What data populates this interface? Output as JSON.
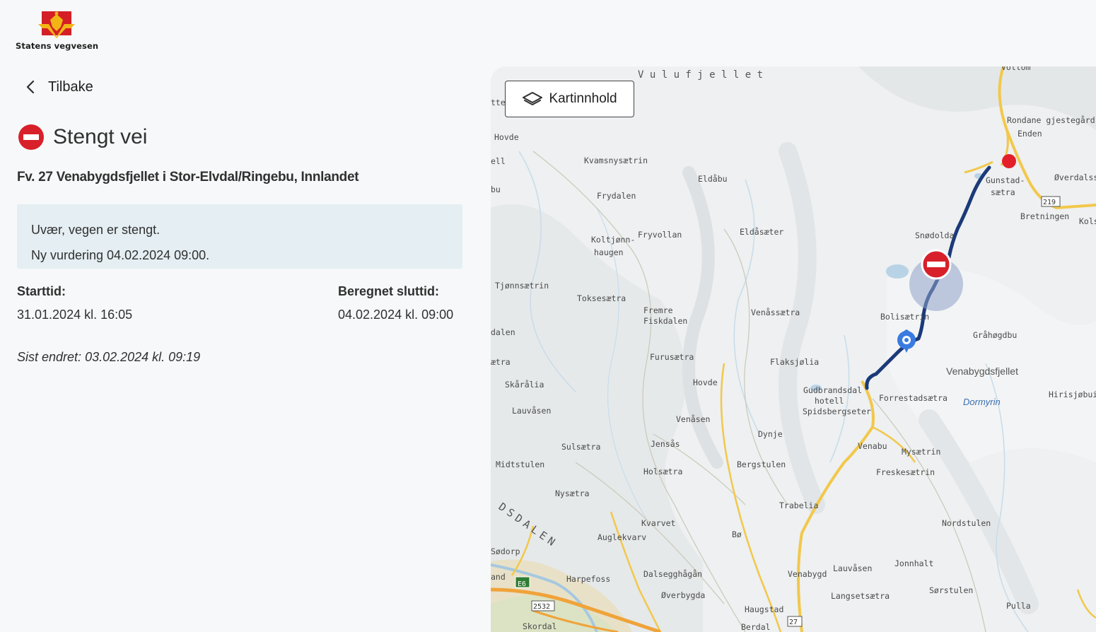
{
  "header": {
    "logo_text": "Statens vegvesen"
  },
  "nav": {
    "back_label": "Tilbake"
  },
  "incident": {
    "status": "Stengt vei",
    "road": "Fv. 27 Venabygdsfjellet i Stor-Elvdal/Ringebu, Innlandet",
    "message_line1": "Uvær, vegen er stengt.",
    "message_line2": "Ny vurdering 04.02.2024 09:00.",
    "start_label": "Starttid:",
    "start_value": "31.01.2024 kl. 16:05",
    "end_label": "Beregnet sluttid:",
    "end_value": "04.02.2024 kl. 09:00",
    "changed_label": "Sist endret:",
    "changed_value": "03.02.2024 kl. 09:19",
    "status_color": "#d8202a"
  },
  "map": {
    "layers_button": "Kartinnhold",
    "route_color": "#1b3a7a",
    "labels": [
      {
        "text": "V u l u f j e l l e t"
      },
      {
        "text": "Hovde"
      },
      {
        "text": "Kvamsnysætrin"
      },
      {
        "text": "Eldåbu"
      },
      {
        "text": "Frydalen"
      },
      {
        "text": "Koltjønn-"
      },
      {
        "text": "haugen"
      },
      {
        "text": "Fryvollan"
      },
      {
        "text": "Eldåsæter"
      },
      {
        "text": "Tjønnsætrin"
      },
      {
        "text": "Toksesætra"
      },
      {
        "text": "Fremre"
      },
      {
        "text": "Fiskdalen"
      },
      {
        "text": "Venåssætra"
      },
      {
        "text": "dalen"
      },
      {
        "text": "Furusætra"
      },
      {
        "text": "Flaksjølia"
      },
      {
        "text": "ætra"
      },
      {
        "text": "Skårålia"
      },
      {
        "text": "Hovde"
      },
      {
        "text": "Lauvåsen"
      },
      {
        "text": "Venåsen"
      },
      {
        "text": "Gudbrandsdal"
      },
      {
        "text": "hotell"
      },
      {
        "text": "Spidsbergseter"
      },
      {
        "text": "Forrestadsætra"
      },
      {
        "text": "Dormyrin"
      },
      {
        "text": "Hirisjøbuin"
      },
      {
        "text": "Venabygdsfjellet"
      },
      {
        "text": "Gråhøgdbu"
      },
      {
        "text": "Bolisætrin"
      },
      {
        "text": "Snødolda"
      },
      {
        "text": "Rondane gjestegård"
      },
      {
        "text": "Enden"
      },
      {
        "text": "Gunstad-"
      },
      {
        "text": "sætra"
      },
      {
        "text": "Øverdalss"
      },
      {
        "text": "Bretningen"
      },
      {
        "text": "Kols"
      },
      {
        "text": "Sulsætra"
      },
      {
        "text": "Jensås"
      },
      {
        "text": "Dynje"
      },
      {
        "text": "Venabu"
      },
      {
        "text": "Mysætrin"
      },
      {
        "text": "Midtstulen"
      },
      {
        "text": "Holsætra"
      },
      {
        "text": "Bergstulen"
      },
      {
        "text": "Freskesætrin"
      },
      {
        "text": "Nysætra"
      },
      {
        "text": "Trabelia"
      },
      {
        "text": "Nordstulen"
      },
      {
        "text": "Kvarvet"
      },
      {
        "text": "Auglekvarv"
      },
      {
        "text": "Bø"
      },
      {
        "text": "DSDALEN"
      },
      {
        "text": "Sødorp"
      },
      {
        "text": "Jonnhalt"
      },
      {
        "text": "Lauvåsen"
      },
      {
        "text": "Harpefoss"
      },
      {
        "text": "Dalsegghågån"
      },
      {
        "text": "Venabygd"
      },
      {
        "text": "Sørstulen"
      },
      {
        "text": "Øverbygda"
      },
      {
        "text": "Langsetsætra"
      },
      {
        "text": "Haugstad"
      },
      {
        "text": "Pulla"
      },
      {
        "text": "Skordal"
      },
      {
        "text": "Berdal"
      },
      {
        "text": "E6"
      },
      {
        "text": "2532"
      },
      {
        "text": "219"
      },
      {
        "text": "27"
      },
      {
        "text": "and"
      },
      {
        "text": "ell"
      },
      {
        "text": "tter"
      },
      {
        "text": "bu"
      },
      {
        "text": "Vollom"
      }
    ]
  }
}
